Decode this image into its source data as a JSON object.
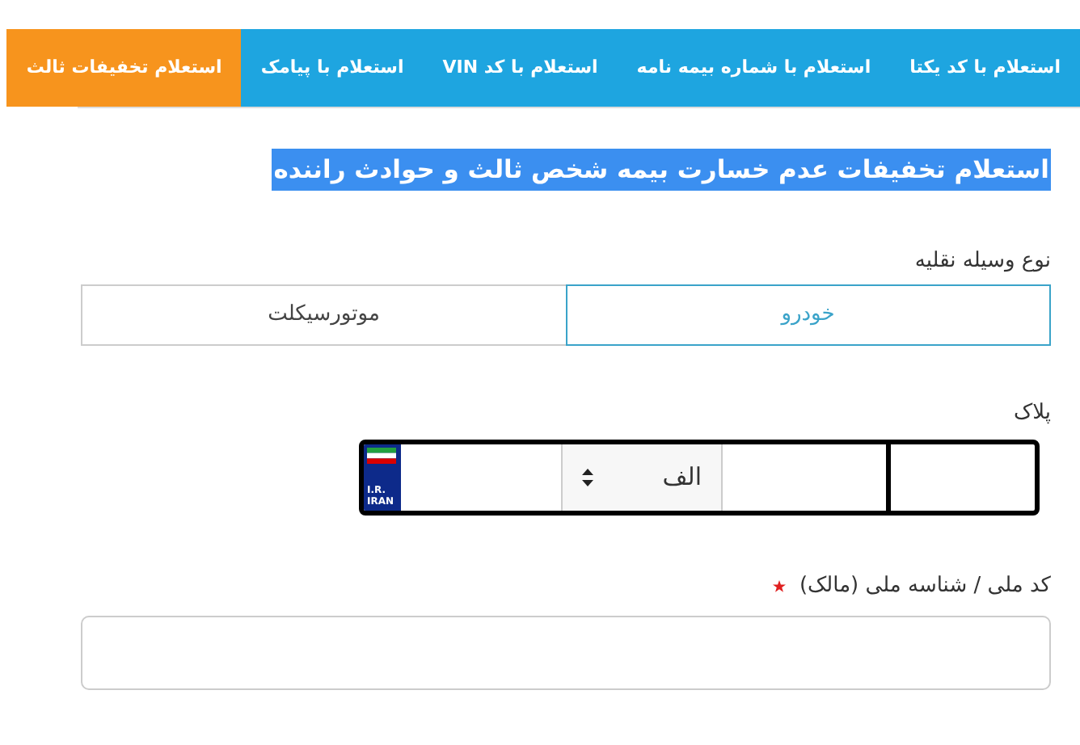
{
  "tabs": [
    {
      "label": "استعلام با کد یکتا",
      "selected": false
    },
    {
      "label": "استعلام با شماره بیمه نامه",
      "selected": false
    },
    {
      "label": "استعلام با کد VIN",
      "selected": false
    },
    {
      "label": "استعلام با پیامک",
      "selected": false
    },
    {
      "label": "استعلام تخفیفات ثالث",
      "selected": true
    }
  ],
  "heading": "استعلام تخفیفات عدم خسارت بیمه شخص ثالث و حوادث راننده",
  "vehicle_type": {
    "label": "نوع وسیله نقلیه",
    "options": [
      {
        "label": "خودرو",
        "selected": true
      },
      {
        "label": "موتورسیکلت",
        "selected": false
      }
    ]
  },
  "plate": {
    "label": "پلاک",
    "letter": "الف",
    "country_code": "I.R.",
    "country": "IRAN"
  },
  "national_id": {
    "label": "کد ملی / شناسه ملی (مالک)",
    "required": true
  }
}
